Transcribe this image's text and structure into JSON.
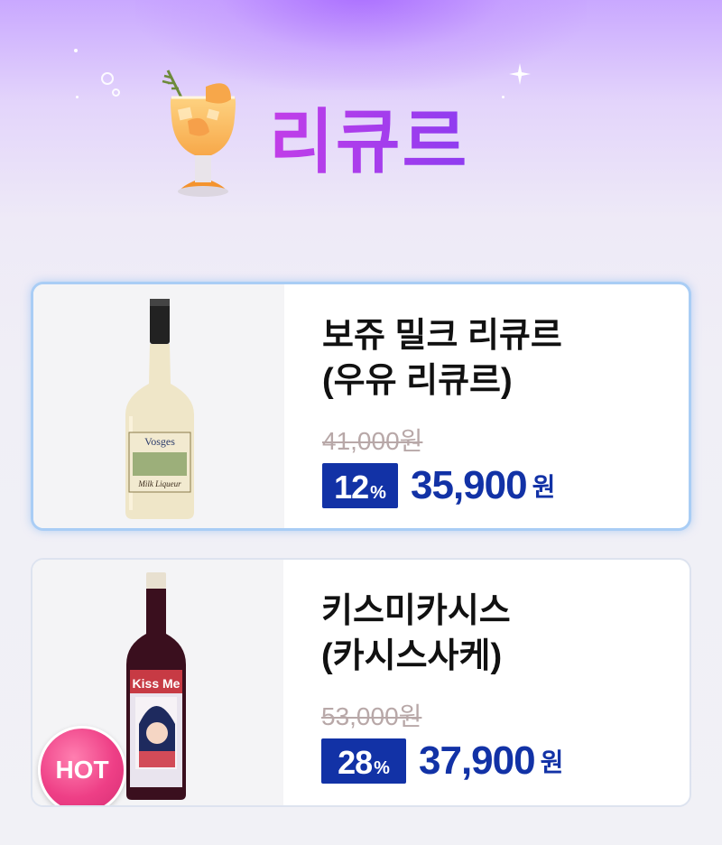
{
  "header": {
    "title": "리큐르",
    "icon": "cocktail-glass-icon"
  },
  "products": [
    {
      "name_line1": "보쥬 밀크 리큐르",
      "name_line2": "(우유 리큐르)",
      "original_price": "41,000원",
      "discount_num": "12",
      "discount_pct": "%",
      "sale_price": "35,900",
      "currency": "원",
      "label_text": "Vosges",
      "label_script": "Milk Liqueur",
      "selected": true
    },
    {
      "name_line1": "키스미카시스",
      "name_line2": "(카시스사케)",
      "original_price": "53,000원",
      "discount_num": "28",
      "discount_pct": "%",
      "sale_price": "37,900",
      "currency": "원",
      "badge": "HOT",
      "label_text": "Kiss Me"
    }
  ],
  "colors": {
    "accent_purple": "#8e3cf0",
    "price_blue": "#1232a6",
    "hot_pink": "#ee3f86"
  }
}
